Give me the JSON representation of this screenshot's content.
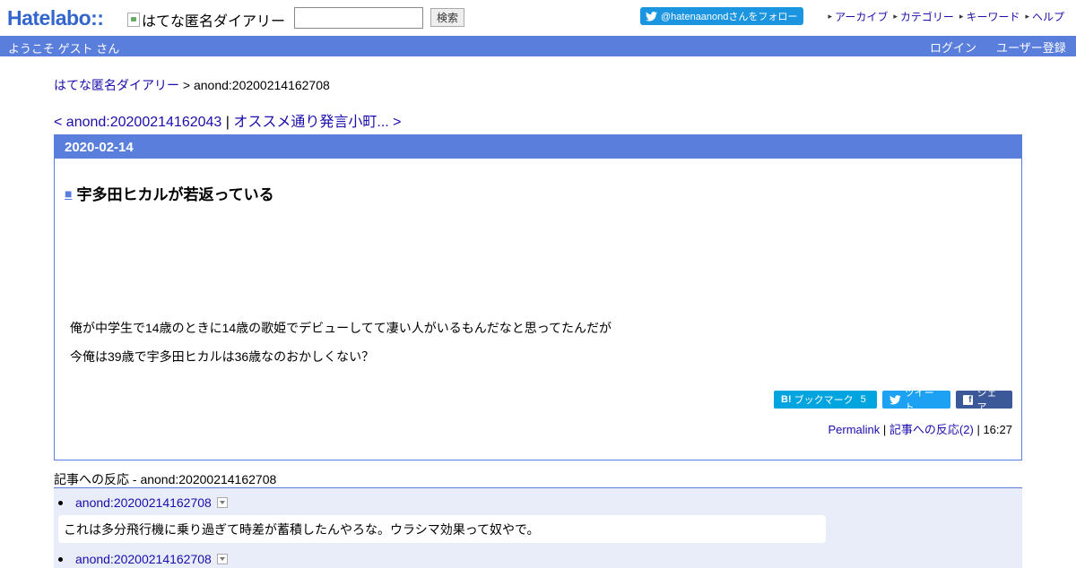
{
  "header": {
    "logo_text": "Hatelabo::",
    "site_image_alt": "はてな匿名ダイアリー",
    "search_button": "検索",
    "follow_button": "@hatenaanondさんをフォロー",
    "links": [
      "アーカイブ",
      "カテゴリー",
      "キーワード",
      "ヘルプ"
    ]
  },
  "welcome": {
    "message": "ようこそ ゲスト さん",
    "login": "ログイン",
    "register": "ユーザー登録"
  },
  "breadcrumb": {
    "home": "はてな匿名ダイアリー",
    "separator": ">",
    "current": "anond:20200214162708"
  },
  "nav": {
    "prev": "< anond:20200214162043",
    "separator": "|",
    "next": "オススメ通り発言小町... >"
  },
  "article": {
    "date": "2020-02-14",
    "title_marker": "■",
    "title": "宇多田ヒカルが若返っている",
    "paragraphs": [
      "俺が中学生で14歳のときに14歳の歌姫でデビューしてて凄い人がいるもんだなと思ってたんだが",
      "今俺は39歳で宇多田ヒカルは36歳なのおかしくない？"
    ],
    "share": {
      "bookmark_label": "ブックマーク",
      "bookmark_count": "5",
      "tweet_label": "ツイート",
      "share_label": "シェア"
    },
    "meta": {
      "permalink": "Permalink",
      "sep1": "|",
      "reactions_link": "記事への反応(2)",
      "sep2": "|",
      "time": "16:27"
    }
  },
  "reactions": {
    "title": "記事への反応 - anond:20200214162708",
    "items": [
      {
        "link": "anond:20200214162708",
        "text": "これは多分飛行機に乗り過ぎて時差が蓄積したんやろな。ウラシマ効果って奴やで。"
      },
      {
        "link": "anond:20200214162708"
      }
    ]
  },
  "colors": {
    "accent": "#5a7edc",
    "link": "#1a0dab",
    "twitter": "#1da1f2",
    "hatebu": "#00a4de",
    "facebook": "#3b5998"
  }
}
